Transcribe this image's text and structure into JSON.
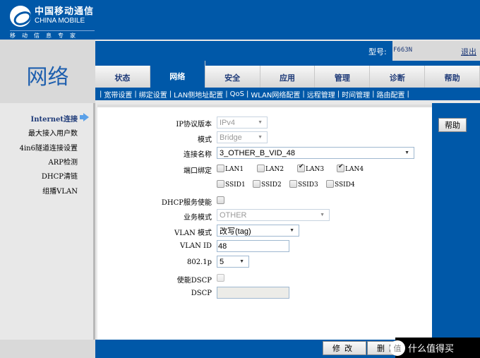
{
  "brand": {
    "name_cn": "中国移动通信",
    "name_en": "CHINA MOBILE",
    "slogan": "移动信息专家",
    "primary_color": "#0058a8"
  },
  "header": {
    "section_title": "网络",
    "model_label": "型号:",
    "model_value": "F663N",
    "logout_label": "退出"
  },
  "tabs": [
    {
      "label": "状态",
      "active": false
    },
    {
      "label": "网络",
      "active": true
    },
    {
      "label": "安全",
      "active": false
    },
    {
      "label": "应用",
      "active": false
    },
    {
      "label": "管理",
      "active": false
    },
    {
      "label": "诊断",
      "active": false
    },
    {
      "label": "帮助",
      "active": false
    }
  ],
  "subnav": [
    {
      "label": "宽带设置",
      "active": true
    },
    {
      "label": "绑定设置"
    },
    {
      "label": "LAN侧地址配置"
    },
    {
      "label": "QoS"
    },
    {
      "label": "WLAN网络配置"
    },
    {
      "label": "远程管理"
    },
    {
      "label": "时间管理"
    },
    {
      "label": "路由配置"
    }
  ],
  "sidebar": [
    {
      "label": "Internet连接",
      "active": true
    },
    {
      "label": "最大接入用户数"
    },
    {
      "label": "4in6隧道连接设置"
    },
    {
      "label": "ARP检测"
    },
    {
      "label": "DHCP清链"
    },
    {
      "label": "组播VLAN"
    }
  ],
  "form": {
    "ip_version": {
      "label": "IP协议版本",
      "value": "IPv4"
    },
    "mode": {
      "label": "模式",
      "value": "Bridge"
    },
    "connection_name": {
      "label": "连接名称",
      "value": "3_OTHER_B_VID_48"
    },
    "port_binding": {
      "label": "端口绑定",
      "ports": [
        {
          "label": "LAN1",
          "checked": false
        },
        {
          "label": "LAN2",
          "checked": false
        },
        {
          "label": "LAN3",
          "checked": true
        },
        {
          "label": "LAN4",
          "checked": true
        },
        {
          "label": "SSID1",
          "checked": false
        },
        {
          "label": "SSID2",
          "checked": false
        },
        {
          "label": "SSID3",
          "checked": false
        },
        {
          "label": "SSID4",
          "checked": false
        }
      ]
    },
    "dhcp_enable": {
      "label": "DHCP服务使能",
      "checked": false
    },
    "service_mode": {
      "label": "业务模式",
      "value": "OTHER"
    },
    "vlan_mode": {
      "label": "VLAN 模式",
      "value": "改写(tag)"
    },
    "vlan_id": {
      "label": "VLAN ID",
      "value": "48"
    },
    "dot1p": {
      "label": "802.1p",
      "value": "5"
    },
    "dscp_enable": {
      "label": "使能DSCP",
      "checked": false
    },
    "dscp": {
      "label": "DSCP",
      "value": ""
    }
  },
  "buttons": {
    "help": "帮助",
    "modify": "修改",
    "delete": "删除"
  },
  "watermark": {
    "badge": "值",
    "text": "什么值得买"
  }
}
